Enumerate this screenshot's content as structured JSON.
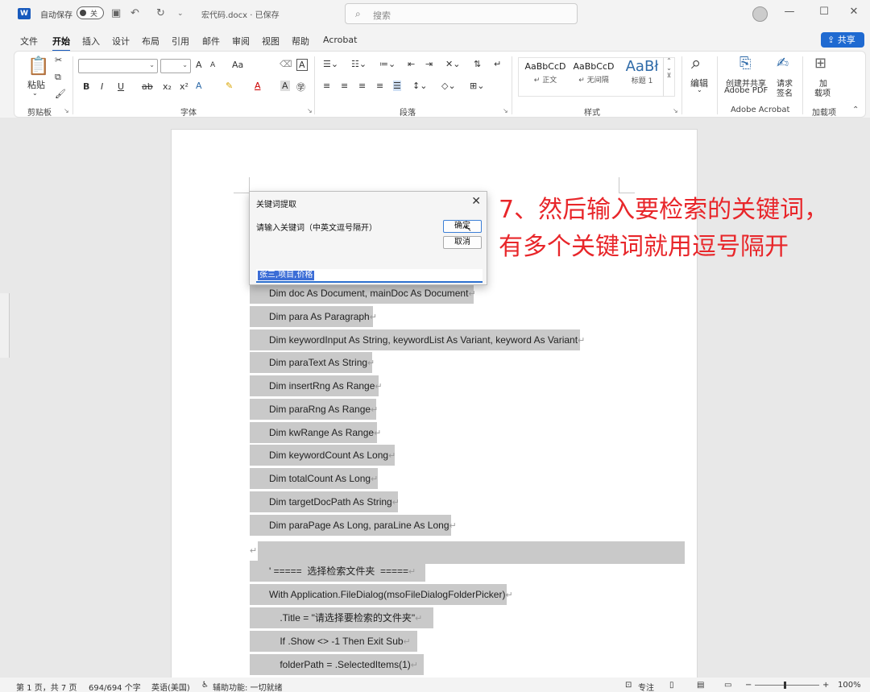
{
  "titlebar": {
    "autosave_label": "自动保存",
    "autosave_state": "关",
    "doc_title": "宏代码.docx · 已保存",
    "search_placeholder": "搜索"
  },
  "menu": {
    "tabs": [
      "文件",
      "开始",
      "插入",
      "设计",
      "布局",
      "引用",
      "邮件",
      "审阅",
      "视图",
      "帮助",
      "Acrobat"
    ],
    "active_tab": "开始",
    "share_label": "共享"
  },
  "ribbon": {
    "clipboard": {
      "paste_label": "粘贴",
      "group_label": "剪贴板"
    },
    "font": {
      "group_label": "字体",
      "grow": "A",
      "shrink": "A",
      "case": "Aa",
      "bold": "B",
      "italic": "I",
      "underline": "U",
      "strike": "ab",
      "subscript": "x₂",
      "superscript": "x²"
    },
    "paragraph": {
      "group_label": "段落"
    },
    "styles": {
      "group_label": "样式",
      "items": [
        {
          "sample": "AaBbCcD",
          "name": "↵ 正文"
        },
        {
          "sample": "AaBbCcD",
          "name": "↵ 无间隔"
        },
        {
          "sample": "AaBł",
          "name": "标题 1"
        }
      ]
    },
    "editing": {
      "label": "编辑"
    },
    "acrobat": {
      "create_label_1": "创建并共享",
      "create_label_2": "Adobe PDF",
      "sign_label_1": "请求",
      "sign_label_2": "签名",
      "group_label": "Adobe Acrobat"
    },
    "addins": {
      "label_1": "加",
      "label_2": "载项",
      "group_label": "加载项"
    }
  },
  "dialog": {
    "title": "关键词提取",
    "prompt": "请输入关键词（中英文逗号隔开）",
    "ok_label": "确定",
    "cancel_label": "取消",
    "input_value": "张三,项目,价格"
  },
  "annotation": {
    "line1": "7、然后输入要检索的关键词，",
    "line2": "有多个关键词就用逗号隔开"
  },
  "code_lines": [
    "Dim doc As Document, mainDoc As Document",
    "Dim para As Paragraph",
    "Dim keywordInput As String, keywordList As Variant, keyword As Variant",
    "Dim paraText As String",
    "Dim insertRng As Range",
    "Dim paraRng As Range",
    "Dim kwRange As Range",
    "Dim keywordCount As Long",
    "Dim totalCount As Long",
    "Dim targetDocPath As String",
    "Dim paraPage As Long, paraLine As Long",
    "",
    "' =====  选择检索文件夹  =====",
    "With Application.FileDialog(msoFileDialogFolderPicker)",
    "    .Title = \"请选择要检索的文件夹\"",
    "    If .Show <> -1 Then Exit Sub",
    "    folderPath = .SelectedItems(1)"
  ],
  "statusbar": {
    "page": "第 1 页，共 7 页",
    "words": "694/694 个字",
    "language": "英语(美国)",
    "accessibility": "辅助功能: 一切就绪",
    "focus": "专注",
    "zoom": "100%"
  },
  "colors": {
    "accent": "#185abd",
    "annotation": "#e8262a",
    "selection": "#c9c9c9"
  }
}
